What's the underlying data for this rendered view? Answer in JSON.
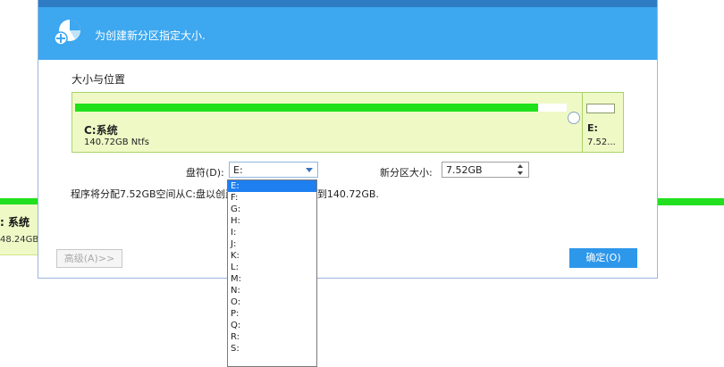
{
  "background_app": {
    "partition_name": ": 系统",
    "partition_size": "48.24GB"
  },
  "dialog": {
    "header_text": "为创建新分区指定大小.",
    "section_title": "大小与位置",
    "partition_map": {
      "c_name": "C:系统",
      "c_size": "140.72GB Ntfs",
      "e_name": "E:",
      "e_size": "7.52..."
    },
    "drive_letter_label": "盘符(D):",
    "drive_letter_value": "E:",
    "size_label": "新分区大小:",
    "size_value": "7.52GB",
    "info_text": "程序将分配7.52GB空间从C:盘以创建新分区,C:盘将减小到140.72GB.",
    "advanced_button": "高级(A)>>",
    "ok_button": "确定(O)",
    "dropdown_options": [
      "E:",
      "F:",
      "G:",
      "H:",
      "I:",
      "J:",
      "K:",
      "L:",
      "M:",
      "N:",
      "O:",
      "P:",
      "Q:",
      "R:",
      "S:"
    ],
    "dropdown_selected": "E:"
  },
  "colors": {
    "header": "#3da7ef",
    "used_bar": "#1ee11a",
    "partition_bg": "#eff9c6",
    "ok_button": "#2d97ea",
    "selection": "#1e7ff0"
  },
  "icons": {
    "header_icon": "partition-add-icon"
  }
}
